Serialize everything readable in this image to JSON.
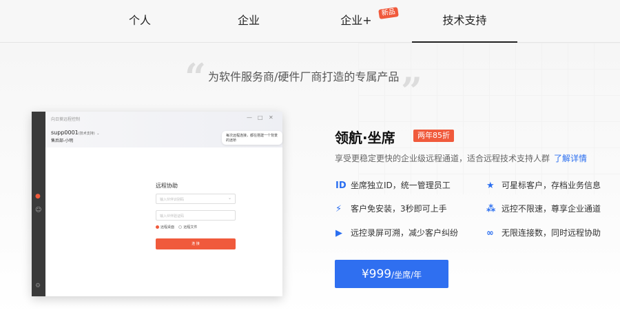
{
  "nav": {
    "tabs": [
      {
        "label": "个人"
      },
      {
        "label": "企业"
      },
      {
        "label": "企业+"
      },
      {
        "label": "技术支持"
      }
    ],
    "new_badge": "新品",
    "active_tab": "技术支持"
  },
  "hero": {
    "slogan": "为软件服务商/硬件厂商打造的专属产品"
  },
  "app_preview": {
    "window_title": "向日葵远程控制",
    "user_id": "supp0001",
    "user_role": "(技术支持)",
    "user_dept": "售后部-小明",
    "tip": "每次远程连接，都在搭建一个背景的迷桥",
    "form_title": "远程协助",
    "input_id_placeholder": "输入伙伴识别码",
    "input_code_placeholder": "输入伙伴验证码",
    "radio_desktop": "远程桌面",
    "radio_file": "远程文件",
    "button": "连 接"
  },
  "product": {
    "name": "领航·坐席",
    "badge": "两年85折",
    "desc": "享受更稳定更快的企业级远程通道，适合远程技术支持人群",
    "more_link": "了解详情",
    "features": [
      {
        "icon": "id-icon",
        "glyph": "ID",
        "text": "坐席独立ID，统一管理员工"
      },
      {
        "icon": "star-icon",
        "glyph": "★",
        "text": "可星标客户，存档业务信息"
      },
      {
        "icon": "lightning-icon",
        "glyph": "⚡",
        "text": "客户免安装，3秒即可上手"
      },
      {
        "icon": "network-icon",
        "glyph": "⁂",
        "text": "远控不限速，尊享企业通道"
      },
      {
        "icon": "video-icon",
        "glyph": "▶",
        "text": "远控录屏可溯，减少客户纠纷"
      },
      {
        "icon": "infinity-icon",
        "glyph": "∞",
        "text": "无限连接数，同时远程协助"
      }
    ],
    "price": "¥999",
    "price_unit": "/坐席/年"
  },
  "colors": {
    "accent_orange": "#f05a3c",
    "accent_blue": "#2f6ff0"
  }
}
